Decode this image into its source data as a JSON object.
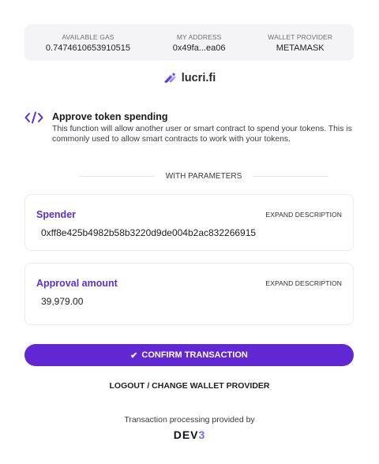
{
  "info_bar": {
    "gas_label": "AVAILABLE GAS",
    "gas_value": "0.7474610653910515",
    "address_label": "MY ADDRESS",
    "address_value": "0x49fa...ea06",
    "provider_label": "WALLET PROVIDER",
    "provider_value": "METAMASK"
  },
  "brand": {
    "name": "lucri.fi",
    "icon": "lucri-logo-icon"
  },
  "function": {
    "icon": "code-icon",
    "title": "Approve token spending",
    "description": "This function will allow another user or smart contract to spend your tokens. This is commonly used to allow smart contracts to work with your tokens."
  },
  "divider_label": "WITH PARAMETERS",
  "params": [
    {
      "name": "Spender",
      "expand_label": "EXPAND DESCRIPTION",
      "value": "0xff8e425b4982b58b3220d9de004b2ac832266915"
    },
    {
      "name": "Approval amount",
      "expand_label": "EXPAND DESCRIPTION",
      "value": "39,979.00"
    }
  ],
  "confirm": {
    "icon": "check-icon",
    "label": "CONFIRM TRANSACTION"
  },
  "logout_label": "LOGOUT / CHANGE WALLET PROVIDER",
  "footer": {
    "provided_text": "Transaction processing provided by",
    "logo_main": "DEV",
    "logo_accent": "3"
  },
  "colors": {
    "accent": "#6127d4",
    "param_name": "#5b2fd1",
    "info_bg": "#f4f4f6"
  }
}
